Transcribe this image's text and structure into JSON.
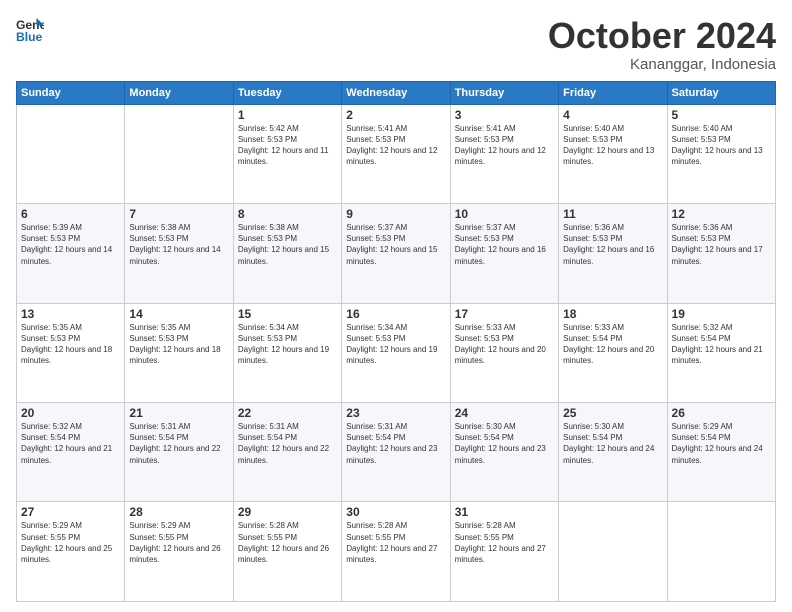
{
  "logo": {
    "line1": "General",
    "line2": "Blue"
  },
  "title": "October 2024",
  "subtitle": "Kananggar, Indonesia",
  "days_header": [
    "Sunday",
    "Monday",
    "Tuesday",
    "Wednesday",
    "Thursday",
    "Friday",
    "Saturday"
  ],
  "weeks": [
    [
      {
        "day": "",
        "sunrise": "",
        "sunset": "",
        "daylight": ""
      },
      {
        "day": "",
        "sunrise": "",
        "sunset": "",
        "daylight": ""
      },
      {
        "day": "1",
        "sunrise": "Sunrise: 5:42 AM",
        "sunset": "Sunset: 5:53 PM",
        "daylight": "Daylight: 12 hours and 11 minutes."
      },
      {
        "day": "2",
        "sunrise": "Sunrise: 5:41 AM",
        "sunset": "Sunset: 5:53 PM",
        "daylight": "Daylight: 12 hours and 12 minutes."
      },
      {
        "day": "3",
        "sunrise": "Sunrise: 5:41 AM",
        "sunset": "Sunset: 5:53 PM",
        "daylight": "Daylight: 12 hours and 12 minutes."
      },
      {
        "day": "4",
        "sunrise": "Sunrise: 5:40 AM",
        "sunset": "Sunset: 5:53 PM",
        "daylight": "Daylight: 12 hours and 13 minutes."
      },
      {
        "day": "5",
        "sunrise": "Sunrise: 5:40 AM",
        "sunset": "Sunset: 5:53 PM",
        "daylight": "Daylight: 12 hours and 13 minutes."
      }
    ],
    [
      {
        "day": "6",
        "sunrise": "Sunrise: 5:39 AM",
        "sunset": "Sunset: 5:53 PM",
        "daylight": "Daylight: 12 hours and 14 minutes."
      },
      {
        "day": "7",
        "sunrise": "Sunrise: 5:38 AM",
        "sunset": "Sunset: 5:53 PM",
        "daylight": "Daylight: 12 hours and 14 minutes."
      },
      {
        "day": "8",
        "sunrise": "Sunrise: 5:38 AM",
        "sunset": "Sunset: 5:53 PM",
        "daylight": "Daylight: 12 hours and 15 minutes."
      },
      {
        "day": "9",
        "sunrise": "Sunrise: 5:37 AM",
        "sunset": "Sunset: 5:53 PM",
        "daylight": "Daylight: 12 hours and 15 minutes."
      },
      {
        "day": "10",
        "sunrise": "Sunrise: 5:37 AM",
        "sunset": "Sunset: 5:53 PM",
        "daylight": "Daylight: 12 hours and 16 minutes."
      },
      {
        "day": "11",
        "sunrise": "Sunrise: 5:36 AM",
        "sunset": "Sunset: 5:53 PM",
        "daylight": "Daylight: 12 hours and 16 minutes."
      },
      {
        "day": "12",
        "sunrise": "Sunrise: 5:36 AM",
        "sunset": "Sunset: 5:53 PM",
        "daylight": "Daylight: 12 hours and 17 minutes."
      }
    ],
    [
      {
        "day": "13",
        "sunrise": "Sunrise: 5:35 AM",
        "sunset": "Sunset: 5:53 PM",
        "daylight": "Daylight: 12 hours and 18 minutes."
      },
      {
        "day": "14",
        "sunrise": "Sunrise: 5:35 AM",
        "sunset": "Sunset: 5:53 PM",
        "daylight": "Daylight: 12 hours and 18 minutes."
      },
      {
        "day": "15",
        "sunrise": "Sunrise: 5:34 AM",
        "sunset": "Sunset: 5:53 PM",
        "daylight": "Daylight: 12 hours and 19 minutes."
      },
      {
        "day": "16",
        "sunrise": "Sunrise: 5:34 AM",
        "sunset": "Sunset: 5:53 PM",
        "daylight": "Daylight: 12 hours and 19 minutes."
      },
      {
        "day": "17",
        "sunrise": "Sunrise: 5:33 AM",
        "sunset": "Sunset: 5:53 PM",
        "daylight": "Daylight: 12 hours and 20 minutes."
      },
      {
        "day": "18",
        "sunrise": "Sunrise: 5:33 AM",
        "sunset": "Sunset: 5:54 PM",
        "daylight": "Daylight: 12 hours and 20 minutes."
      },
      {
        "day": "19",
        "sunrise": "Sunrise: 5:32 AM",
        "sunset": "Sunset: 5:54 PM",
        "daylight": "Daylight: 12 hours and 21 minutes."
      }
    ],
    [
      {
        "day": "20",
        "sunrise": "Sunrise: 5:32 AM",
        "sunset": "Sunset: 5:54 PM",
        "daylight": "Daylight: 12 hours and 21 minutes."
      },
      {
        "day": "21",
        "sunrise": "Sunrise: 5:31 AM",
        "sunset": "Sunset: 5:54 PM",
        "daylight": "Daylight: 12 hours and 22 minutes."
      },
      {
        "day": "22",
        "sunrise": "Sunrise: 5:31 AM",
        "sunset": "Sunset: 5:54 PM",
        "daylight": "Daylight: 12 hours and 22 minutes."
      },
      {
        "day": "23",
        "sunrise": "Sunrise: 5:31 AM",
        "sunset": "Sunset: 5:54 PM",
        "daylight": "Daylight: 12 hours and 23 minutes."
      },
      {
        "day": "24",
        "sunrise": "Sunrise: 5:30 AM",
        "sunset": "Sunset: 5:54 PM",
        "daylight": "Daylight: 12 hours and 23 minutes."
      },
      {
        "day": "25",
        "sunrise": "Sunrise: 5:30 AM",
        "sunset": "Sunset: 5:54 PM",
        "daylight": "Daylight: 12 hours and 24 minutes."
      },
      {
        "day": "26",
        "sunrise": "Sunrise: 5:29 AM",
        "sunset": "Sunset: 5:54 PM",
        "daylight": "Daylight: 12 hours and 24 minutes."
      }
    ],
    [
      {
        "day": "27",
        "sunrise": "Sunrise: 5:29 AM",
        "sunset": "Sunset: 5:55 PM",
        "daylight": "Daylight: 12 hours and 25 minutes."
      },
      {
        "day": "28",
        "sunrise": "Sunrise: 5:29 AM",
        "sunset": "Sunset: 5:55 PM",
        "daylight": "Daylight: 12 hours and 26 minutes."
      },
      {
        "day": "29",
        "sunrise": "Sunrise: 5:28 AM",
        "sunset": "Sunset: 5:55 PM",
        "daylight": "Daylight: 12 hours and 26 minutes."
      },
      {
        "day": "30",
        "sunrise": "Sunrise: 5:28 AM",
        "sunset": "Sunset: 5:55 PM",
        "daylight": "Daylight: 12 hours and 27 minutes."
      },
      {
        "day": "31",
        "sunrise": "Sunrise: 5:28 AM",
        "sunset": "Sunset: 5:55 PM",
        "daylight": "Daylight: 12 hours and 27 minutes."
      },
      {
        "day": "",
        "sunrise": "",
        "sunset": "",
        "daylight": ""
      },
      {
        "day": "",
        "sunrise": "",
        "sunset": "",
        "daylight": ""
      }
    ]
  ]
}
